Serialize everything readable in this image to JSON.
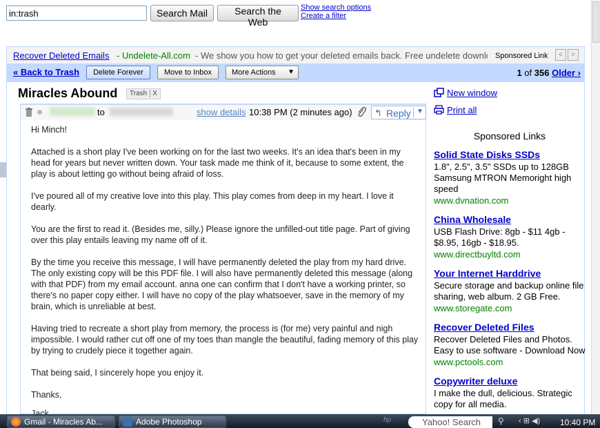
{
  "search": {
    "query": "in:trash",
    "search_mail_label": "Search Mail",
    "search_web_label": "Search the Web",
    "options_link": "Show search options",
    "filter_link": "Create a filter"
  },
  "top_ad": {
    "link": "Recover Deleted Emails",
    "domain": "- Undelete-All.com",
    "text": "- We show you how to get your deleted emails back. Free undelete downlo",
    "label": "Sponsored Link",
    "prev": "<",
    "next": ">"
  },
  "toolbar": {
    "back": "« Back to Trash",
    "delete": "Delete Forever",
    "inbox": "Move to Inbox",
    "more": "More Actions",
    "pager_current": "1",
    "pager_of": "of",
    "pager_total": "356",
    "older": "Older ›"
  },
  "message": {
    "subject": "Miracles Abound",
    "label": "Trash",
    "label_remove": "X",
    "to_label": "to",
    "show_details": "show details",
    "time": "10:38 PM (2 minutes ago)",
    "reply": "Reply",
    "greeting": "Hi Minch!",
    "paragraphs": [
      "Attached is a short play I've been working on for the last two weeks. It's an idea that's been in my head for years but never written down. Your task made me think of it, because to some extent, the play is about letting go without being afraid of loss.",
      "I've poured all of my creative love into this play. This play comes from deep in my heart. I love it dearly.",
      "You are the first to read it. (Besides me, silly.) Please ignore the unfilled-out title page. Part of giving over this play entails leaving my name off of it.",
      "By the time you receive this message, I will have permanently deleted the play from my hard drive. The only existing copy will be this PDF file. I will also have permanently deleted this message (along with that PDF) from my email account. anna one can confirm that I don't have a working printer, so there's no paper copy either. I will have no copy of the play whatsoever, save in the memory of my brain, which is unreliable at best.",
      "Having tried to recreate a short play from memory, the process is (for me) very painful and nigh impossible. I would rather cut off one of my toes than mangle the beautiful, fading memory of this play by trying to crudely piece it together again.",
      "That being said, I sincerely hope you enjoy it.",
      "Thanks,"
    ],
    "closing_partial": "Jack"
  },
  "sidebar": {
    "new_window": "New window",
    "print_all": "Print all",
    "title": "Sponsored Links",
    "ads": [
      {
        "title": "Solid State Disks SSDs",
        "desc": "1.8\", 2.5\", 3.5\" SSDs up to 128GB Samsung MTRON Memoright high speed",
        "url": "www.dvnation.com"
      },
      {
        "title": "China Wholesale",
        "desc": "USB Flash Drive: 8gb - $11 4gb - $8.95, 16gb - $18.95.",
        "url": "www.directbuyltd.com"
      },
      {
        "title": "Your Internet Harddrive",
        "desc": "Secure storage and backup online file sharing, web album. 2 GB Free.",
        "url": "www.storegate.com"
      },
      {
        "title": "Recover Deleted Files",
        "desc": "Recover Deleted Files and Photos. Easy to use software - Download Now",
        "url": "www.pctools.com"
      },
      {
        "title": "Copywriter deluxe",
        "desc": "I make the dull, delicious. Strategic copy for all media.",
        "url": ""
      }
    ]
  },
  "taskbar": {
    "gmail_task": "Gmail - Miracles Ab...",
    "ps_task": "Adobe Photoshop",
    "hp": "hp",
    "yahoo_search": "Yahoo! Search",
    "clock": "10:40 PM"
  },
  "colors": {
    "toolbar_bg": "#c3d9ff",
    "link": "#0000cc",
    "ad_url": "#008000"
  }
}
